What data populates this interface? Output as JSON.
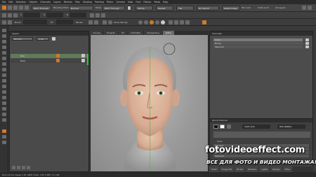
{
  "menu": [
    "File",
    "Edit",
    "Selection",
    "Objects",
    "Channels",
    "Layers",
    "Patches",
    "Files",
    "Shading",
    "Painting",
    "Filters",
    "Camera",
    "View",
    "Font",
    "Python",
    "Pasta",
    "Help"
  ],
  "toolbar1": {
    "paint_through": "Paint Through",
    "blending_mode_label": "Blending Mode",
    "blending_mode_value": "Normal",
    "mode_label": "Mode",
    "mode_value": "Paint Through",
    "stamp": "Stamp",
    "repeat": "Repeat",
    "tile": "Tile",
    "no_stencil": "No Stencil",
    "reset_image": "Reset Image",
    "fan_lock": "Fan Lock",
    "scale_lock": "Scale Lock",
    "all_layers": "All Layers"
  },
  "toolbar2": {
    "size": "S",
    "opacity": "O",
    "rotate": "R"
  },
  "toolbar3": {
    "brush": "Brush",
    "fit": "Fit",
    "terrain": "Terrain",
    "tonal_density": "Tonal density"
  },
  "layers_panel": {
    "title": "Layers",
    "mode": "Normal",
    "opacity_value": "1.00",
    "rows": [
      "Skin",
      "Base"
    ]
  },
  "viewport": {
    "tabs": [
      "Canvas",
      "Projects",
      "UV",
      "Orthofiler",
      "Perspective",
      "Ortho"
    ],
    "active_tab": "Ortho"
  },
  "channels_panel": {
    "title": "Channels",
    "rows": [
      "Color",
      "Bump",
      "Specular"
    ]
  },
  "quick_channel": {
    "title": "Quick Channel",
    "field1": "1024 (1K)",
    "field2": "8bit (BGRA)",
    "color_label": "Color",
    "rows": [
      "General",
      "Default",
      "Bump",
      "Specular"
    ]
  },
  "shelf_tabs": [
    "Shelf",
    "Image Ma",
    "Brush",
    "Shaders",
    "Lights",
    "Ramps",
    "Filter"
  ],
  "status_bar": "Disk Cache Usage  1.81 GB/8  Video: 443.3 MB / 4.1 GB",
  "watermark": {
    "site": "fotovideoeffect.com",
    "slogan": "ВСЕ ДЛЯ ФОТО И ВИДЕО МОНТАЖА!"
  },
  "colors": {
    "accent_orange": "#d07a2a",
    "selection_green": "#29d22b",
    "panel_bg": "#4a4a4a",
    "viewport_bg": "#a4a4a4"
  }
}
